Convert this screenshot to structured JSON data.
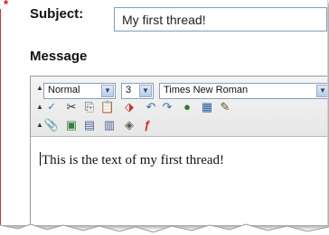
{
  "form": {
    "required_marker": "*",
    "subject_label": "Subject:",
    "subject_value": "My first thread!",
    "message_label": "Message"
  },
  "toolbar": {
    "format_select": "Normal",
    "size_select": "3",
    "font_select": "Times New Roman"
  },
  "editor": {
    "content": "This is the text of my first thread!"
  },
  "colors": {
    "input_border": "#7f9db9",
    "required_star": "#e01010"
  }
}
